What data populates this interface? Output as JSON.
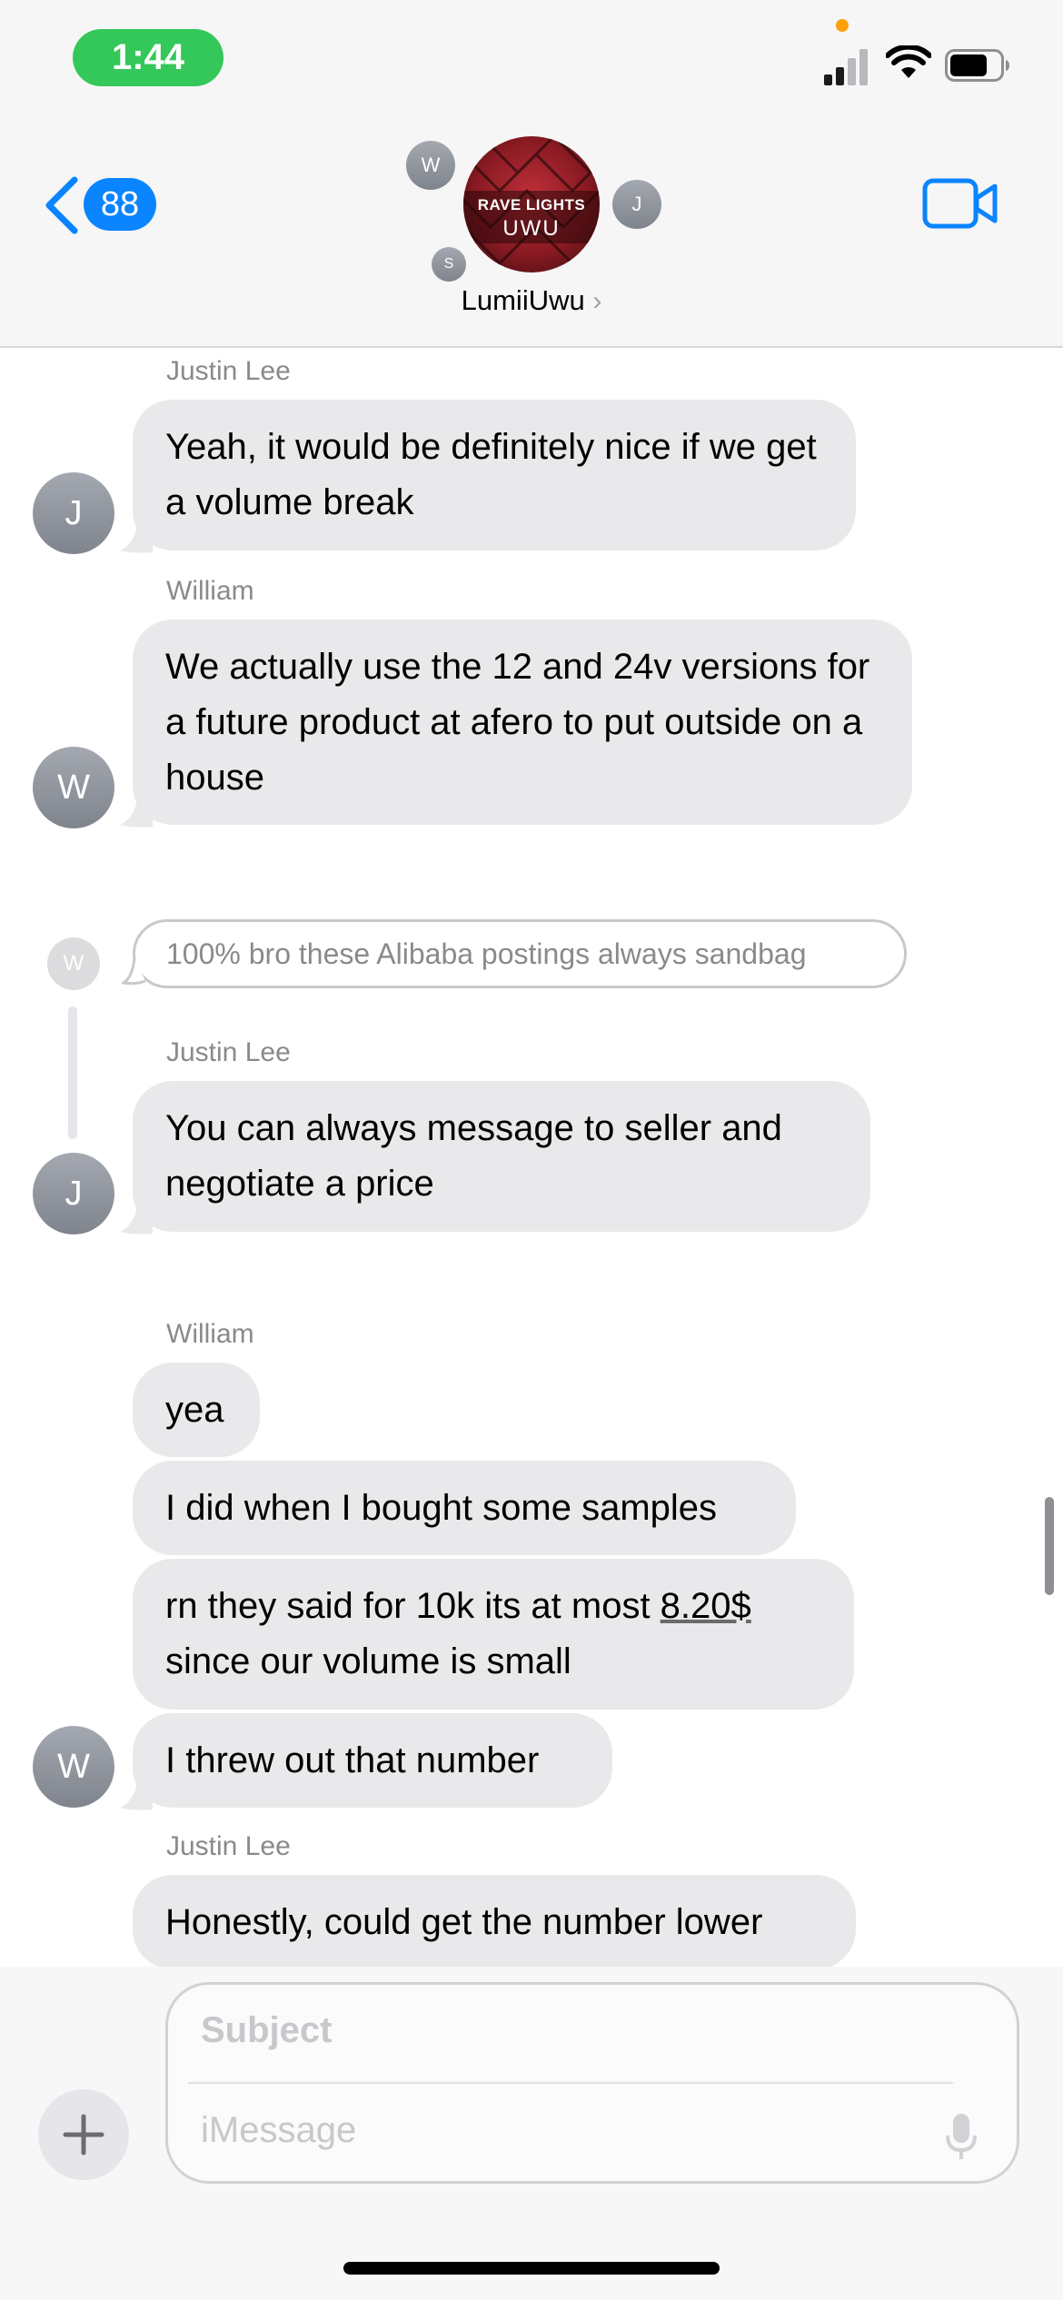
{
  "status_bar": {
    "time": "1:44"
  },
  "nav": {
    "back_count": "88",
    "group_name": "LumiiUwu",
    "group_avatar": {
      "line1": "RAVE LIGHTS",
      "line2": "UWU"
    },
    "members": [
      "W",
      "J",
      "S"
    ]
  },
  "messages": [
    {
      "sender": "Justin Lee",
      "text": "Yeah, it would be definitely nice if we get a volume break",
      "avatar": "J"
    },
    {
      "sender": "William",
      "text": "We actually use the 12 and 24v versions for a future product at afero to put outside on a house",
      "avatar": "W"
    },
    {
      "reply_avatar": "W",
      "reply_text": "100% bro these Alibaba postings always sandbag"
    },
    {
      "sender": "Justin Lee",
      "text": "You can always message to seller and negotiate a price",
      "avatar": "J"
    },
    {
      "sender": "William",
      "texts": [
        "yea",
        "I did when I bought some samples"
      ],
      "avatar": "W"
    },
    {
      "text_pre": "rn they said for 10k its at most ",
      "text_price": "8.20$",
      "text_post": "since our volume is small"
    },
    {
      "text": "I threw out that number"
    },
    {
      "sender": "Justin Lee",
      "text": "Honestly, could get the number lower"
    }
  ],
  "compose": {
    "subject_placeholder": "Subject",
    "message_placeholder": "iMessage"
  },
  "colors": {
    "accent": "#0a84ff",
    "bubble": "#e9e9eb",
    "status_green": "#34c759"
  },
  "icons": [
    "back-chevron-icon",
    "video-camera-icon",
    "plus-icon",
    "microphone-icon",
    "wifi-icon",
    "battery-icon",
    "signal-icon"
  ]
}
